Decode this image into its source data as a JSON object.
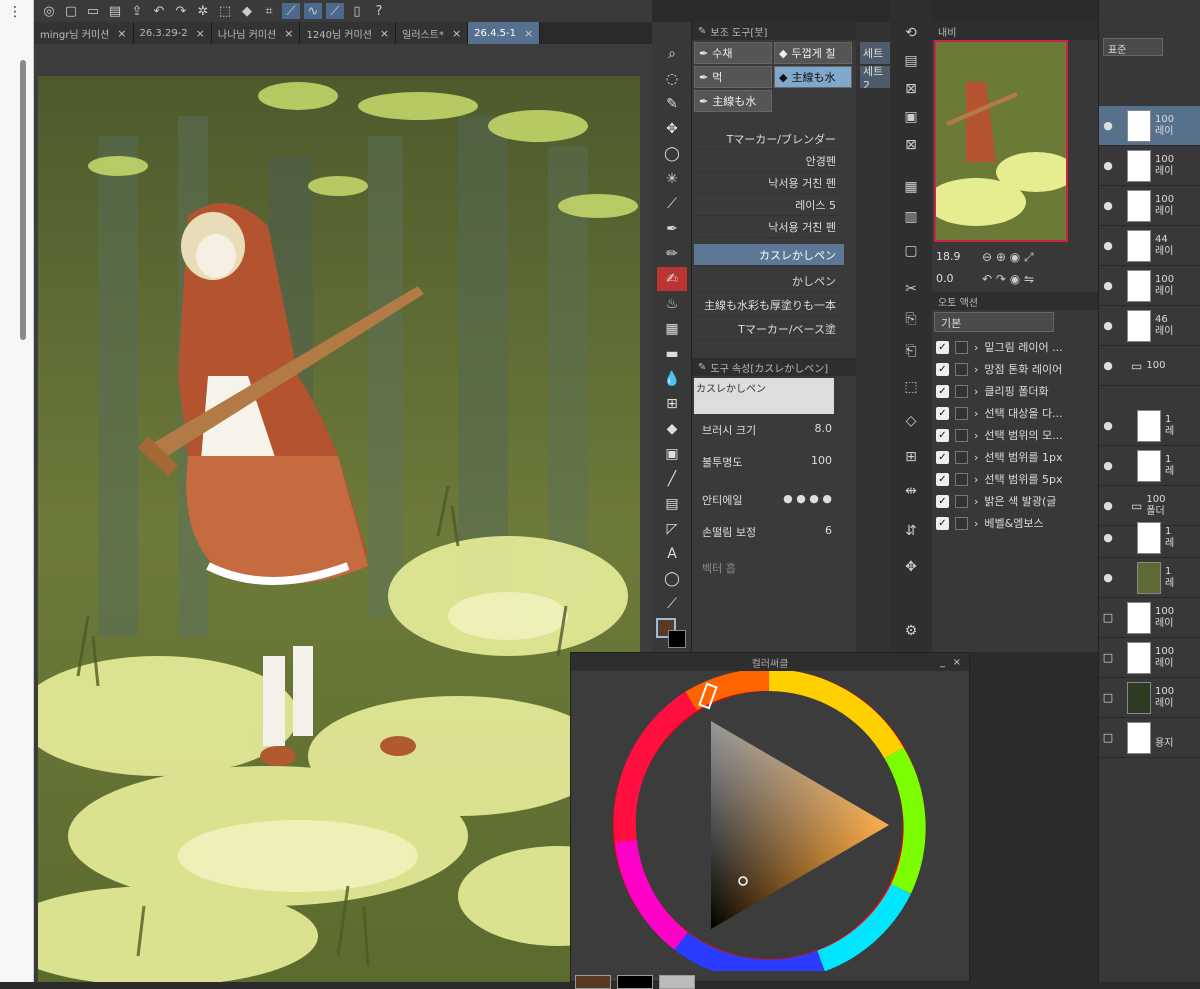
{
  "toolbar": {
    "icons": [
      "logo-icon",
      "new-icon",
      "open-icon",
      "save-icon",
      "export-icon",
      "undo-icon",
      "redo-icon",
      "spinner-icon",
      "transform-icon",
      "fill-icon",
      "crop-icon",
      "stroke-icon",
      "stroke2-icon",
      "stroke3-icon",
      "phone-icon",
      "help-icon"
    ]
  },
  "tabs": [
    {
      "label": "mingr님 커미션",
      "close": "×"
    },
    {
      "label": "26.3.29-2",
      "close": "×"
    },
    {
      "label": "나나님 커미션",
      "close": "×"
    },
    {
      "label": "1240님 커미션",
      "close": "×"
    },
    {
      "label": "일러스트*",
      "close": "×"
    },
    {
      "label": "26.4.5-1",
      "close": "×"
    }
  ],
  "subtool": {
    "header": "보조 도구[붓]",
    "buttons": [
      {
        "label": "수채"
      },
      {
        "label": "두껍게 칠"
      },
      {
        "label": "먹"
      },
      {
        "label": "主線も水"
      },
      {
        "label": "主線も水"
      }
    ],
    "brushes": [
      {
        "label": "Tマーカー/ブレンダー"
      },
      {
        "label": "안경펜"
      },
      {
        "label": "낙서용 거친 펜"
      },
      {
        "label": "레이스 5"
      },
      {
        "label": "낙서용 거친 펜"
      },
      {
        "label": "カスレかしペン"
      },
      {
        "label": "かしペン"
      },
      {
        "label": "主線も水彩も厚塗りも一本"
      },
      {
        "label": "Tマーカー/ベース塗"
      }
    ]
  },
  "toolprop": {
    "header": "도구 속성[カスレかしペン]",
    "brush_name": "カスレかしペン",
    "brush_size_label": "브러시 크기",
    "brush_size": "8.0",
    "opacity_label": "불투명도",
    "opacity": "100",
    "antialias_label": "안티에일",
    "stabilization_label": "손떨림 보정",
    "stabilization": "6",
    "vector_label": "벡터 흡"
  },
  "set": {
    "btn1": "세트",
    "btn2": "세트2"
  },
  "navigator": {
    "tab": "내비",
    "zoom": "18.9",
    "angle": "0.0"
  },
  "auto_action": {
    "header": "오토 액션",
    "set_name": "기본",
    "items": [
      "밑그림 레이어 ...",
      "망점 톤화 레이어",
      "클리핑 폴더화",
      "선택 대상을 다...",
      "선택 범위의 모...",
      "선택 범위를 1px",
      "선택 범위를 5px",
      "밝은 색 발광(글",
      "베벨&엠보스"
    ]
  },
  "layers": {
    "blend_mode": "표준",
    "rows": [
      {
        "pct": "100",
        "name": "레이"
      },
      {
        "pct": "100",
        "name": "레이"
      },
      {
        "pct": "100",
        "name": "레이"
      },
      {
        "pct": "44",
        "name": "레이"
      },
      {
        "pct": "100",
        "name": "레이"
      },
      {
        "pct": "46",
        "name": "레이"
      },
      {
        "pct": "100",
        "name": ""
      },
      {
        "pct": "1",
        "name": "레"
      },
      {
        "pct": "1",
        "name": "레"
      },
      {
        "pct": "100",
        "name": "폴더"
      },
      {
        "pct": "1",
        "name": "레"
      },
      {
        "pct": "1",
        "name": "레"
      },
      {
        "pct": "100",
        "name": "레이"
      },
      {
        "pct": "100",
        "name": "레이"
      },
      {
        "pct": "100",
        "name": "레이"
      },
      {
        "pct": "",
        "name": "용지"
      }
    ]
  },
  "color_panel": {
    "title": "컬러써클",
    "main_color": "#5a3a24",
    "sub_color": "#000000",
    "hue_color": "#ff8c00"
  }
}
